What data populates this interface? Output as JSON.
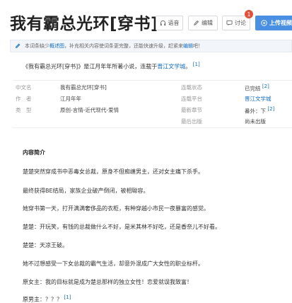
{
  "page": {
    "title": "我有霸总光环[穿书]"
  },
  "toolbar": {
    "voice_label": "语音",
    "edit_label": "编辑",
    "discuss_label": "讨论",
    "discuss_badge": "1",
    "upload_label": "上传视频"
  },
  "notice": {
    "text_before": "本词条缺少",
    "link1": "概述图",
    "text_after": "，补充相关内容使词条更完整，还能快速升级，赶紧来",
    "link2": "编辑",
    "text_end": "吧！"
  },
  "summary": {
    "text_before": "《我有霸总光环[穿书]》是江月年年所著小说，连载于",
    "link": "晋江文学城",
    "text_after": "。",
    "ref": "[1]"
  },
  "info": {
    "rows": [
      {
        "l1": "中文名",
        "v1": "我有霸总光环[穿书]",
        "l2": "连载状态",
        "v2": "已完结",
        "ref": "[2]"
      },
      {
        "l1": "作　者",
        "v1": "江月年年",
        "l2": "连载平台",
        "v2": "晋江文学城",
        "ref": ""
      },
      {
        "l1": "类　型",
        "v1": "原创-言情-近代现代-爱情",
        "l2": "最新章节",
        "v2": "番外：下",
        "ref": "[2]"
      },
      {
        "l1": "",
        "v1": "",
        "l2": "最后出版",
        "v2": "尚未出版",
        "ref": ""
      }
    ]
  },
  "content": {
    "section_title": "内容简介",
    "paragraphs": [
      "楚楚突然穿成书中恶毒女总裁，原身不但痴缠男主，还对女主痛下杀手。",
      "最终获得BE结局，家族企业破产倒闭，被相聪容。",
      "她穿书第一天，打开满满奢侈品的衣柜，有种穿越小市民一夜暴富的感觉。",
      "楚楚：开玩笑，有钱的总裁做什么不好，是米其林不好吃，还是香奈儿不好看。",
      "楚楚：天凉王破。",
      "她不过想感受一下女总裁的霸气生活，却意外混成广大女性的职业标杆。",
      "原女主：我的目标就是成为楚总那样的独立女性！恋爱就误我致富！",
      "原男主：？？？"
    ],
    "last_ref": "[1]"
  }
}
